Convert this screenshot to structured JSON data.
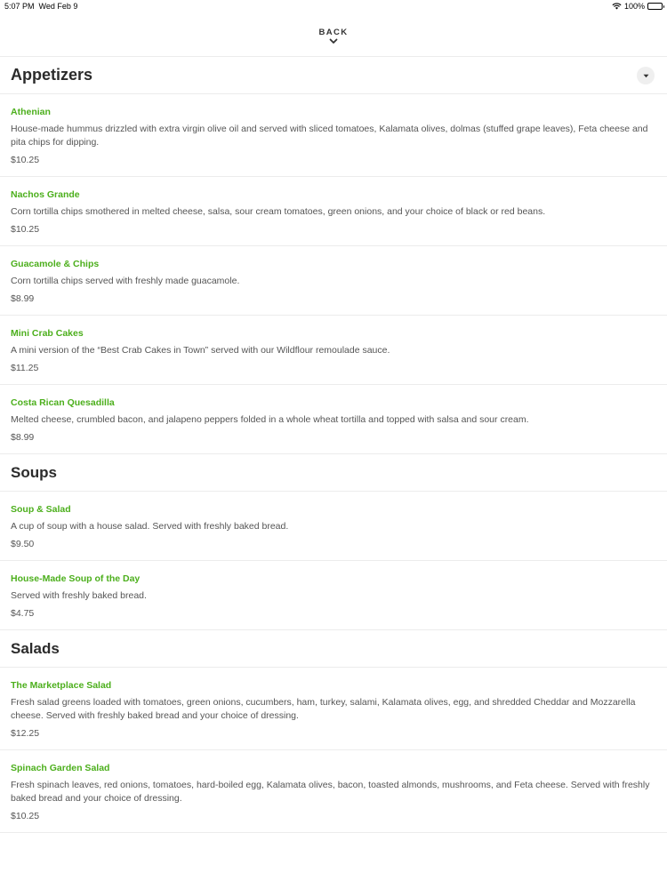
{
  "status_bar": {
    "time": "5:07 PM",
    "date": "Wed Feb 9",
    "battery": "100%",
    "battery_level": 1.0,
    "wifi_icon": "wifi-icon"
  },
  "nav": {
    "back_label": "BACK",
    "chevron_icon": "chevron-down-icon"
  },
  "colors": {
    "item_name": "#4caf1c",
    "text": "#555555",
    "divider": "#ececec"
  },
  "sections": [
    {
      "title": "Appetizers",
      "items": [
        {
          "name": "Athenian",
          "description": "House-made hummus drizzled with extra virgin olive oil and served with sliced tomatoes, Kalamata olives, dolmas (stuffed grape leaves), Feta cheese and pita chips for dipping.",
          "price": "$10.25"
        },
        {
          "name": "Nachos Grande",
          "description": "Corn tortilla chips smothered in melted cheese, salsa, sour cream tomatoes, green onions, and your choice of black or red beans.",
          "price": "$10.25"
        },
        {
          "name": "Guacamole & Chips",
          "description": "Corn tortilla chips served with freshly made guacamole.",
          "price": "$8.99"
        },
        {
          "name": "Mini Crab Cakes",
          "description": "A mini version of the “Best Crab Cakes in Town” served with our Wildflour remoulade sauce.",
          "price": "$11.25"
        },
        {
          "name": "Costa Rican Quesadilla",
          "description": "Melted cheese, crumbled bacon, and jalapeno peppers folded in a whole wheat tortilla and topped with salsa and sour cream.",
          "price": "$8.99"
        }
      ]
    },
    {
      "title": "Soups",
      "items": [
        {
          "name": "Soup & Salad",
          "description": "A cup of soup with a house salad. Served with freshly baked bread.",
          "price": "$9.50"
        },
        {
          "name": "House-Made Soup of the Day",
          "description": "Served with freshly baked bread.",
          "price": "$4.75"
        }
      ]
    },
    {
      "title": "Salads",
      "items": [
        {
          "name": "The Marketplace Salad",
          "description": "Fresh salad greens loaded with tomatoes, green onions, cucumbers, ham, turkey, salami, Kalamata olives, egg, and shredded Cheddar and Mozzarella cheese. Served with freshly baked bread and your choice of dressing.",
          "price": "$12.25"
        },
        {
          "name": "Spinach Garden Salad",
          "description": "Fresh spinach leaves, red onions, tomatoes, hard-boiled egg, Kalamata olives, bacon, toasted almonds, mushrooms, and Feta cheese. Served with freshly baked bread and your choice of dressing.",
          "price": "$10.25"
        }
      ]
    }
  ]
}
